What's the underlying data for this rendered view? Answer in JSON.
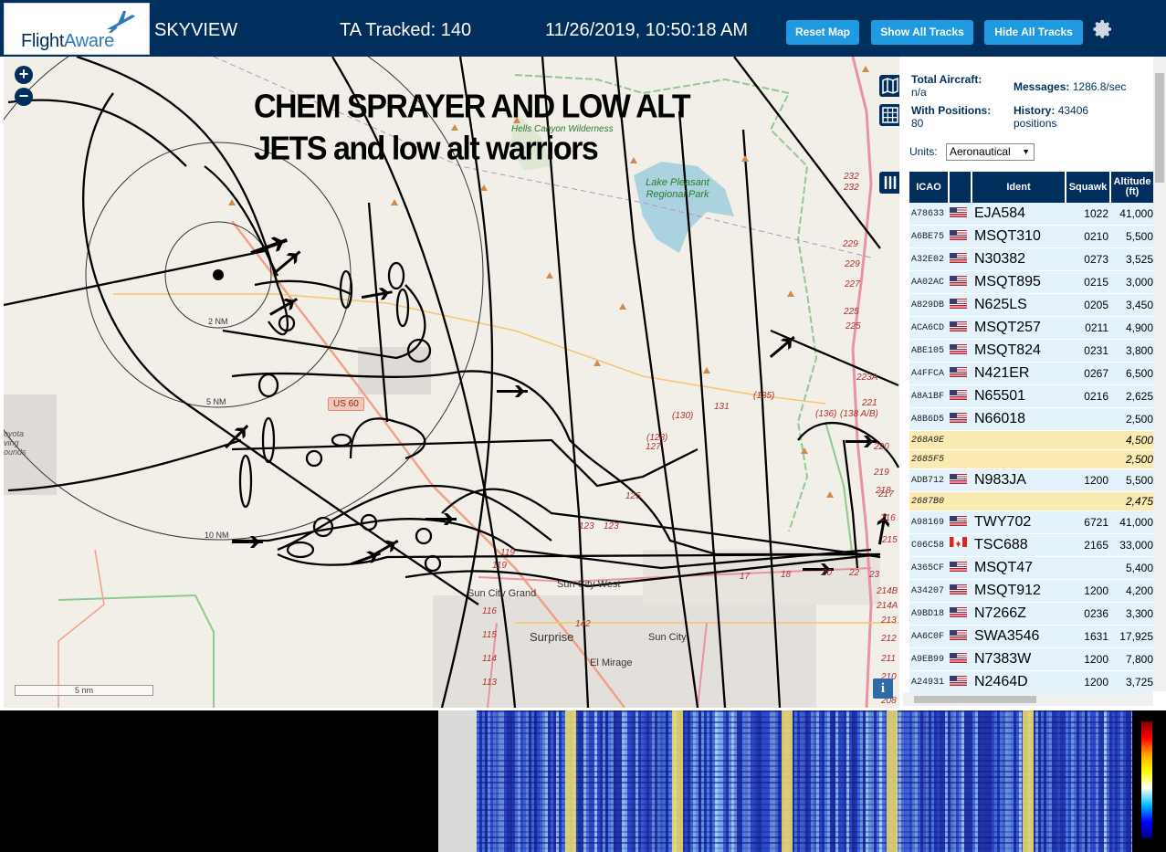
{
  "header": {
    "logo_text_a": "Flight",
    "logo_text_b": "Aware",
    "app_name": "SKYVIEW",
    "tracked": "TA Tracked: 140",
    "datetime": "11/26/2019, 10:50:18 AM",
    "buttons": {
      "reset": "Reset Map",
      "show": "Show All Tracks",
      "hide": "Hide All Tracks"
    }
  },
  "map": {
    "overlay_line1": "CHEM SPRAYER AND LOW ALT",
    "overlay_line2": "JETS and low alt warriors",
    "zoom_in": "+",
    "zoom_out": "−",
    "scale_label": "5 nm",
    "info": "i",
    "ring_labels": [
      "2 NM",
      "5 NM",
      "10 NM"
    ],
    "places": {
      "hells_canyon": "Hells Canyon Wilderness",
      "lake_pleasant": "Lake Pleasant Regional Park",
      "us60": "US 60",
      "sun_city_grand": "Sun City Grand",
      "sun_city_west": "Sun City West",
      "surprise": "Surprise",
      "sun_city": "Sun City",
      "el_mirage": "El Mirage",
      "coyote": "oyota\nving\nounds"
    },
    "road_numbers": [
      "232",
      "232",
      "229",
      "229",
      "227",
      "225",
      "225",
      "223A",
      "221",
      "220",
      "219",
      "218",
      "217",
      "216",
      "215",
      "214B",
      "214A",
      "213",
      "212",
      "211",
      "210",
      "208",
      "(130)",
      "131",
      "(135)",
      "(136)",
      "(138 A/B)",
      "(128)",
      "127",
      "125",
      "123",
      "123",
      "119",
      "119",
      "116",
      "115",
      "114",
      "113",
      "142",
      "17",
      "18",
      "20",
      "22",
      "23"
    ]
  },
  "panel": {
    "total_aircraft_label": "Total Aircraft:",
    "total_aircraft_value": "n/a",
    "with_positions_label": "With Positions:",
    "with_positions_value": "80",
    "messages_label": "Messages:",
    "messages_value": "1286.8/sec",
    "history_label": "History:",
    "history_value": "43406 positions",
    "units_label": "Units:",
    "units_value": "Aeronautical",
    "columns": [
      "ICAO",
      "",
      "Ident",
      "Squawk",
      "Altitude (ft)"
    ],
    "rows": [
      {
        "icao": "A78633",
        "flag": "us",
        "ident": "EJA584",
        "squawk": "1022",
        "alt": "41,000"
      },
      {
        "icao": "A6BE75",
        "flag": "us",
        "ident": "MSQT310",
        "squawk": "0210",
        "alt": "5,500"
      },
      {
        "icao": "A32E02",
        "flag": "us",
        "ident": "N30382",
        "squawk": "0273",
        "alt": "3,525"
      },
      {
        "icao": "AA02AC",
        "flag": "us",
        "ident": "MSQT895",
        "squawk": "0215",
        "alt": "3,000"
      },
      {
        "icao": "A829DB",
        "flag": "us",
        "ident": "N625LS",
        "squawk": "0205",
        "alt": "3,450"
      },
      {
        "icao": "ACA6CD",
        "flag": "us",
        "ident": "MSQT257",
        "squawk": "0211",
        "alt": "4,900"
      },
      {
        "icao": "ABE105",
        "flag": "us",
        "ident": "MSQT824",
        "squawk": "0231",
        "alt": "3,800"
      },
      {
        "icao": "A4FFCA",
        "flag": "us",
        "ident": "N421ER",
        "squawk": "0267",
        "alt": "6,500"
      },
      {
        "icao": "A8A1BF",
        "flag": "us",
        "ident": "N65501",
        "squawk": "0216",
        "alt": "2,625"
      },
      {
        "icao": "A8B6D5",
        "flag": "us",
        "ident": "N66018",
        "squawk": "",
        "alt": "2,500"
      },
      {
        "icao": "268A9E",
        "flag": "",
        "ident": "",
        "squawk": "",
        "alt": "4,500",
        "yellow": true
      },
      {
        "icao": "2685F5",
        "flag": "",
        "ident": "",
        "squawk": "",
        "alt": "2,500",
        "yellow": true
      },
      {
        "icao": "ADB712",
        "flag": "us",
        "ident": "N983JA",
        "squawk": "1200",
        "alt": "5,500"
      },
      {
        "icao": "2687B0",
        "flag": "",
        "ident": "",
        "squawk": "",
        "alt": "2,475",
        "yellow": true
      },
      {
        "icao": "A98169",
        "flag": "us",
        "ident": "TWY702",
        "squawk": "6721",
        "alt": "41,000"
      },
      {
        "icao": "C06C58",
        "flag": "ca",
        "ident": "TSC688",
        "squawk": "2165",
        "alt": "33,000"
      },
      {
        "icao": "A365CF",
        "flag": "us",
        "ident": "MSQT47",
        "squawk": "",
        "alt": "5,400"
      },
      {
        "icao": "A34207",
        "flag": "us",
        "ident": "MSQT912",
        "squawk": "1200",
        "alt": "4,200"
      },
      {
        "icao": "A9BD18",
        "flag": "us",
        "ident": "N7266Z",
        "squawk": "0236",
        "alt": "3,300"
      },
      {
        "icao": "AA6C0F",
        "flag": "us",
        "ident": "SWA3546",
        "squawk": "1631",
        "alt": "17,925"
      },
      {
        "icao": "A9EB99",
        "flag": "us",
        "ident": "N7383W",
        "squawk": "1200",
        "alt": "7,800"
      },
      {
        "icao": "A24931",
        "flag": "us",
        "ident": "N2464D",
        "squawk": "1200",
        "alt": "3,725"
      }
    ]
  },
  "colors": {
    "header_bg": "#002f5d",
    "button_bg": "#1f9ae0",
    "row_bg": "#e4f2fb",
    "row_yellow": "#fbeab2",
    "map_bg": "#f2efe9"
  }
}
